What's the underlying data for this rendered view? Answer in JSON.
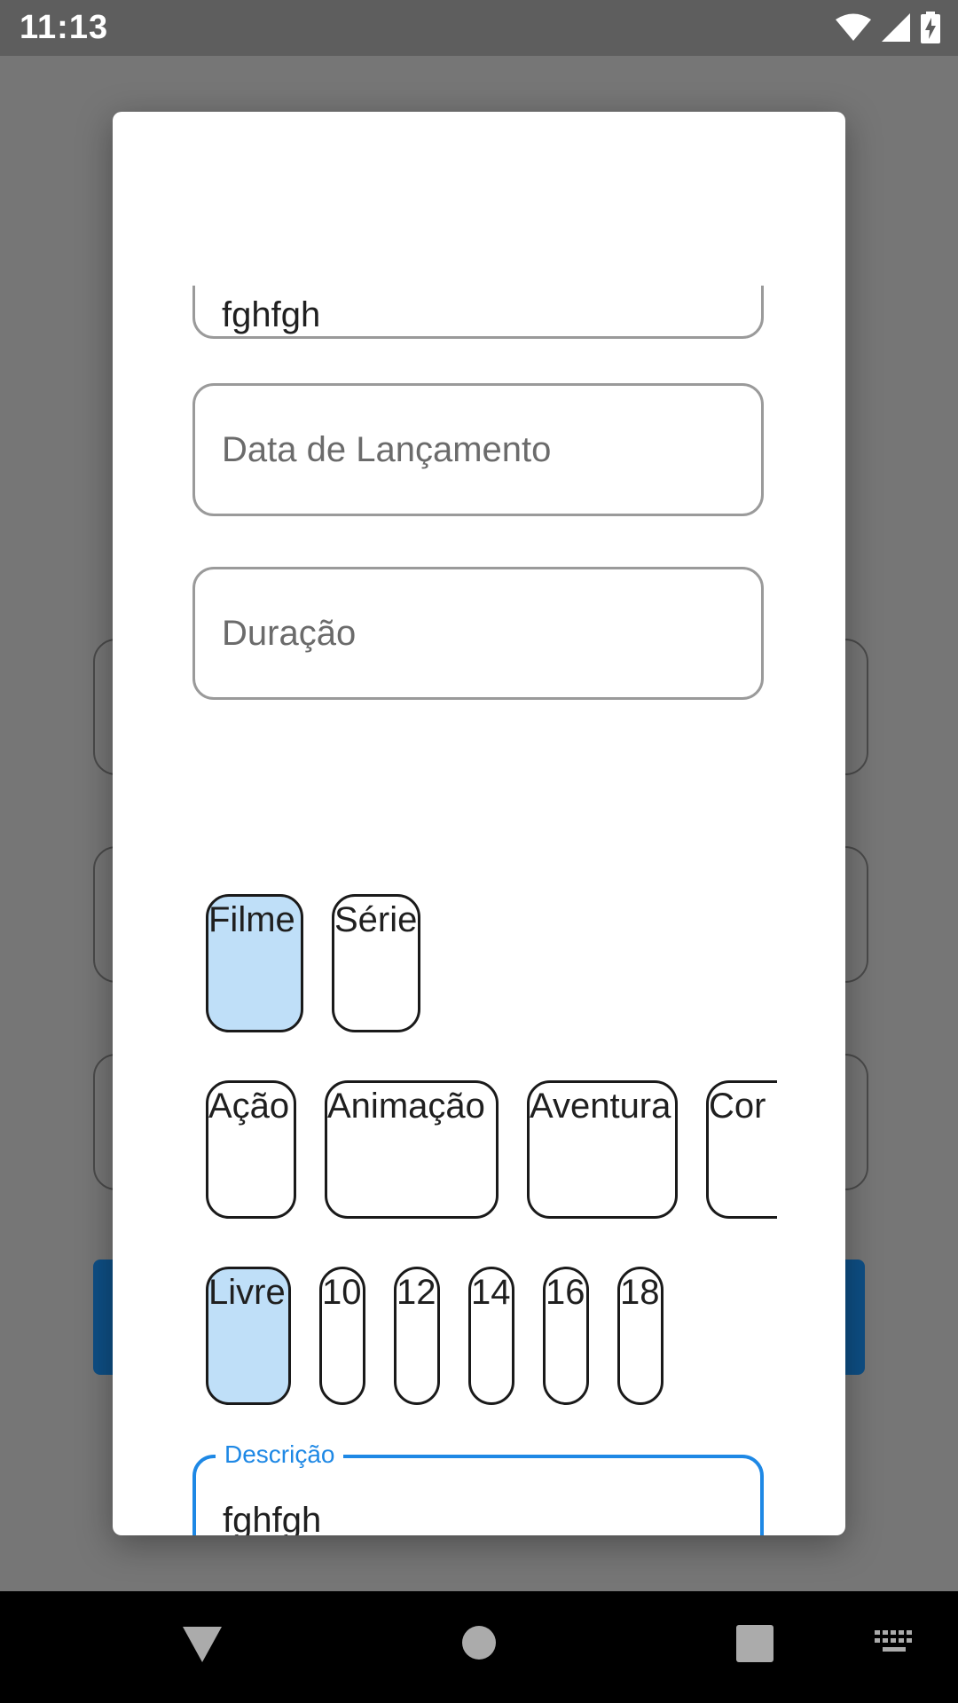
{
  "status_bar": {
    "time": "11:13"
  },
  "form": {
    "title_value": "fghfgh",
    "release_date_placeholder": "Data de Lançamento",
    "duration_placeholder": "Duração",
    "type_chips": [
      {
        "label": "Filme",
        "selected": true
      },
      {
        "label": "Série",
        "selected": false
      }
    ],
    "genre_chips": [
      {
        "label": "Ação",
        "selected": false
      },
      {
        "label": "Animação",
        "selected": false
      },
      {
        "label": "Aventura",
        "selected": false
      },
      {
        "label": "Cor",
        "selected": false
      }
    ],
    "rating_chips": [
      {
        "label": "Livre",
        "selected": true
      },
      {
        "label": "10",
        "selected": false
      },
      {
        "label": "12",
        "selected": false
      },
      {
        "label": "14",
        "selected": false
      },
      {
        "label": "16",
        "selected": false
      },
      {
        "label": "18",
        "selected": false
      }
    ],
    "description_label": "Descrição",
    "description_value": "fghfgh"
  },
  "colors": {
    "accent": "#1e88e5",
    "chip_selected": "#bfdff8",
    "background_button": "#0e4f85"
  },
  "nav_icons": [
    "back-icon",
    "home-icon",
    "recents-icon",
    "keyboard-icon"
  ]
}
